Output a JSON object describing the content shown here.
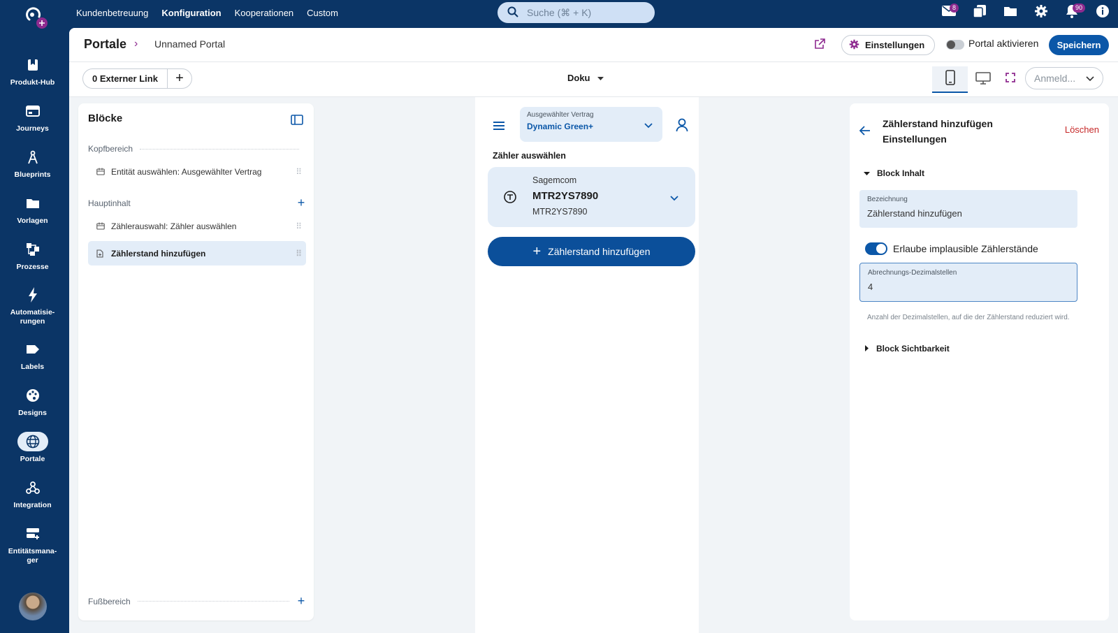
{
  "sidebar": {
    "items": [
      {
        "label": "Produkt-Hub",
        "icon": "bookmark-icon"
      },
      {
        "label": "Journeys",
        "icon": "journeys-icon"
      },
      {
        "label": "Blueprints",
        "icon": "compass-icon"
      },
      {
        "label": "Vorlagen",
        "icon": "folder-icon"
      },
      {
        "label": "Prozesse",
        "icon": "process-icon"
      },
      {
        "label": "Automatisie-\nrungen",
        "icon": "bolt-icon"
      },
      {
        "label": "Labels",
        "icon": "label-icon"
      },
      {
        "label": "Designs",
        "icon": "palette-icon"
      },
      {
        "label": "Portale",
        "icon": "globe-icon"
      },
      {
        "label": "Integration",
        "icon": "webhook-icon"
      },
      {
        "label": "Entitätsmana-\nger",
        "icon": "entity-icon"
      }
    ],
    "active": "Portale"
  },
  "topnav": {
    "links": [
      "Kundenbetreuung",
      "Konfiguration",
      "Kooperationen",
      "Custom"
    ],
    "active": "Konfiguration"
  },
  "search": {
    "placeholder": "Suche (⌘ + K)"
  },
  "top_icons": {
    "mail_badge": "8",
    "notifications_badge": "90"
  },
  "header": {
    "crumb_root": "Portale",
    "crumb_separator": "›",
    "crumb_current": "Unnamed Portal",
    "settings_button": "Einstellungen",
    "activate_label": "Portal aktivieren",
    "save_button": "Speichern"
  },
  "toolbar": {
    "external_link": "0 Externer Link",
    "add": "+",
    "doku": "Doku",
    "login_select": "Anmeld..."
  },
  "blocks_panel": {
    "title": "Blöcke",
    "sections": {
      "header": "Kopfbereich",
      "main": "Hauptinhalt",
      "footer": "Fußbereich"
    },
    "items": [
      {
        "label": "Entität auswählen: Ausgewählter Vertrag"
      },
      {
        "label": "Zählerauswahl: Zähler auswählen"
      },
      {
        "label": "Zählerstand hinzufügen"
      }
    ]
  },
  "preview": {
    "contract_label": "Ausgewählter Vertrag",
    "contract_value": "Dynamic Green+",
    "meter_heading": "Zähler auswählen",
    "meter_vendor": "Sagemcom",
    "meter_id": "MTR2YS7890",
    "meter_id_sub": "MTR2YS7890",
    "add_button": "Zählerstand hinzufügen"
  },
  "settings_panel": {
    "title_line1": "Zählerstand hinzufügen",
    "title_line2": "Einstellungen",
    "delete": "Löschen",
    "section_content": "Block Inhalt",
    "field_label_name": "Bezeichnung",
    "field_value_name": "Zählerstand hinzufügen",
    "switch_label": "Erlaube implausible Zählerstände",
    "field_label_decimals": "Abrechnungs-Dezimalstellen",
    "field_value_decimals": "4",
    "helper": "Anzahl der Dezimalstellen, auf die der Zählerstand reduziert wird.",
    "section_visibility": "Block Sichtbarkeit"
  },
  "colors": {
    "navy": "#0b3566",
    "primary": "#0b57a8",
    "accent_purple": "#8e2a8f",
    "danger": "#c62828",
    "light_blue": "#e3edf8"
  }
}
